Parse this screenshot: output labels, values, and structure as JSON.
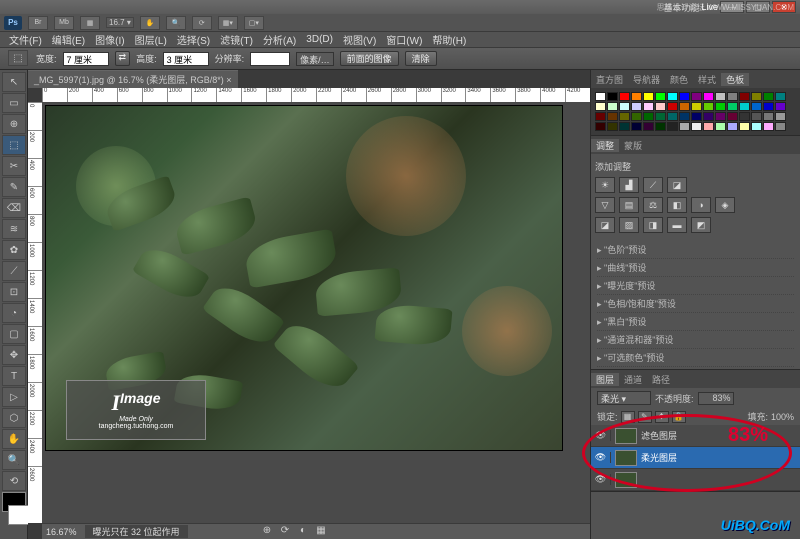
{
  "watermarks": {
    "top": "思缘设计论坛 WWW.MISSYUAN.COM",
    "bottom": "UiBQ.CoM",
    "image_logo": "Image",
    "image_sub": "tangcheng.tuchong.com",
    "image_script": "Made Only"
  },
  "titlebar": {
    "workspace_label": "基本功能",
    "search_placeholder": "Live"
  },
  "appbar": {
    "zoom": "16.7",
    "zoom_suffix": "▾"
  },
  "menu": [
    "文件(F)",
    "编辑(E)",
    "图像(I)",
    "图层(L)",
    "选择(S)",
    "滤镜(T)",
    "分析(A)",
    "3D(D)",
    "视图(V)",
    "窗口(W)",
    "帮助(H)"
  ],
  "options": {
    "width_label": "宽度:",
    "width_value": "7 厘米",
    "height_label": "高度:",
    "height_value": "3 厘米",
    "swap": "⇄",
    "res_label": "分辨率:",
    "res_value": "",
    "unit": "像素/…",
    "front_image": "前面的图像",
    "clear": "清除"
  },
  "tab": {
    "title": "_MG_5997(1).jpg @ 16.7% (柔光图层, RGB/8*)",
    "close": "×"
  },
  "ruler_h": [
    "0",
    "200",
    "400",
    "600",
    "800",
    "1000",
    "1200",
    "1400",
    "1600",
    "1800",
    "2000",
    "2200",
    "2400",
    "2600",
    "2800",
    "3000",
    "3200",
    "3400",
    "3600",
    "3800",
    "4000",
    "4200"
  ],
  "ruler_v": [
    "0",
    "200",
    "400",
    "600",
    "800",
    "1000",
    "1200",
    "1400",
    "1600",
    "1800",
    "2000",
    "2200",
    "2400",
    "2600"
  ],
  "status": {
    "zoom": "16.67%",
    "info": "曝光只在 32 位起作用"
  },
  "panels": {
    "swatch_tabs": [
      "直方图",
      "导航器",
      "颜色",
      "样式",
      "色板"
    ],
    "swatch_active": "色板",
    "adjust_tabs": [
      "调整",
      "蒙版"
    ],
    "adjust_active": "调整",
    "add_adjust": "添加调整",
    "presets": [
      "\"色阶\"预设",
      "\"曲线\"预设",
      "\"曝光度\"预设",
      "\"色相/饱和度\"预设",
      "\"黑白\"预设",
      "\"通道混和器\"预设",
      "\"可选颜色\"预设"
    ],
    "layer_tabs": [
      "图层",
      "通道",
      "路径"
    ],
    "layer_active": "图层",
    "blend_mode": "柔光",
    "opacity_label": "不透明度:",
    "opacity_value": "83%",
    "lock_label": "锁定:",
    "fill_label": "填充:",
    "fill_value": "100%",
    "layers": [
      {
        "name": "滤色图层",
        "visible": true
      },
      {
        "name": "柔光图层",
        "visible": true,
        "selected": true
      },
      {
        "name": "",
        "visible": true
      }
    ]
  },
  "annotation": {
    "text": "83%"
  },
  "colors": {
    "swatches": [
      "#fff",
      "#000",
      "#f00",
      "#ff8000",
      "#ff0",
      "#0f0",
      "#0ff",
      "#00f",
      "#800080",
      "#ff00ff",
      "#c0c0c0",
      "#808080",
      "#800000",
      "#808000",
      "#008000",
      "#008080",
      "#ffc",
      "#cfc",
      "#cff",
      "#ccf",
      "#fcf",
      "#fcc",
      "#c00",
      "#c60",
      "#cc0",
      "#6c0",
      "#0c0",
      "#0c6",
      "#0cc",
      "#06c",
      "#00c",
      "#60c",
      "#600",
      "#630",
      "#660",
      "#360",
      "#060",
      "#063",
      "#066",
      "#036",
      "#006",
      "#306",
      "#606",
      "#603",
      "#333",
      "#555",
      "#777",
      "#999",
      "#300",
      "#330",
      "#033",
      "#003",
      "#303",
      "#030",
      "#222",
      "#aaa",
      "#eee",
      "#faa",
      "#afa",
      "#aaf",
      "#ffa",
      "#aff",
      "#faf",
      "#888"
    ]
  },
  "tools": [
    "↖",
    "▭",
    "⊕",
    "⬚",
    "✂",
    "✎",
    "⌫",
    "≋",
    "✿",
    "⟋",
    "⊡",
    "◔",
    "▢",
    "✥",
    "T",
    "▷",
    "⬡",
    "✋",
    "🔍",
    "⟲"
  ],
  "iconstrip": [
    "🎨",
    "📊",
    "⬚",
    "⚙",
    "A",
    "¶",
    "⬛",
    "📋"
  ],
  "footer_icons": [
    "⊕",
    "⟳",
    "◐",
    "▦"
  ]
}
